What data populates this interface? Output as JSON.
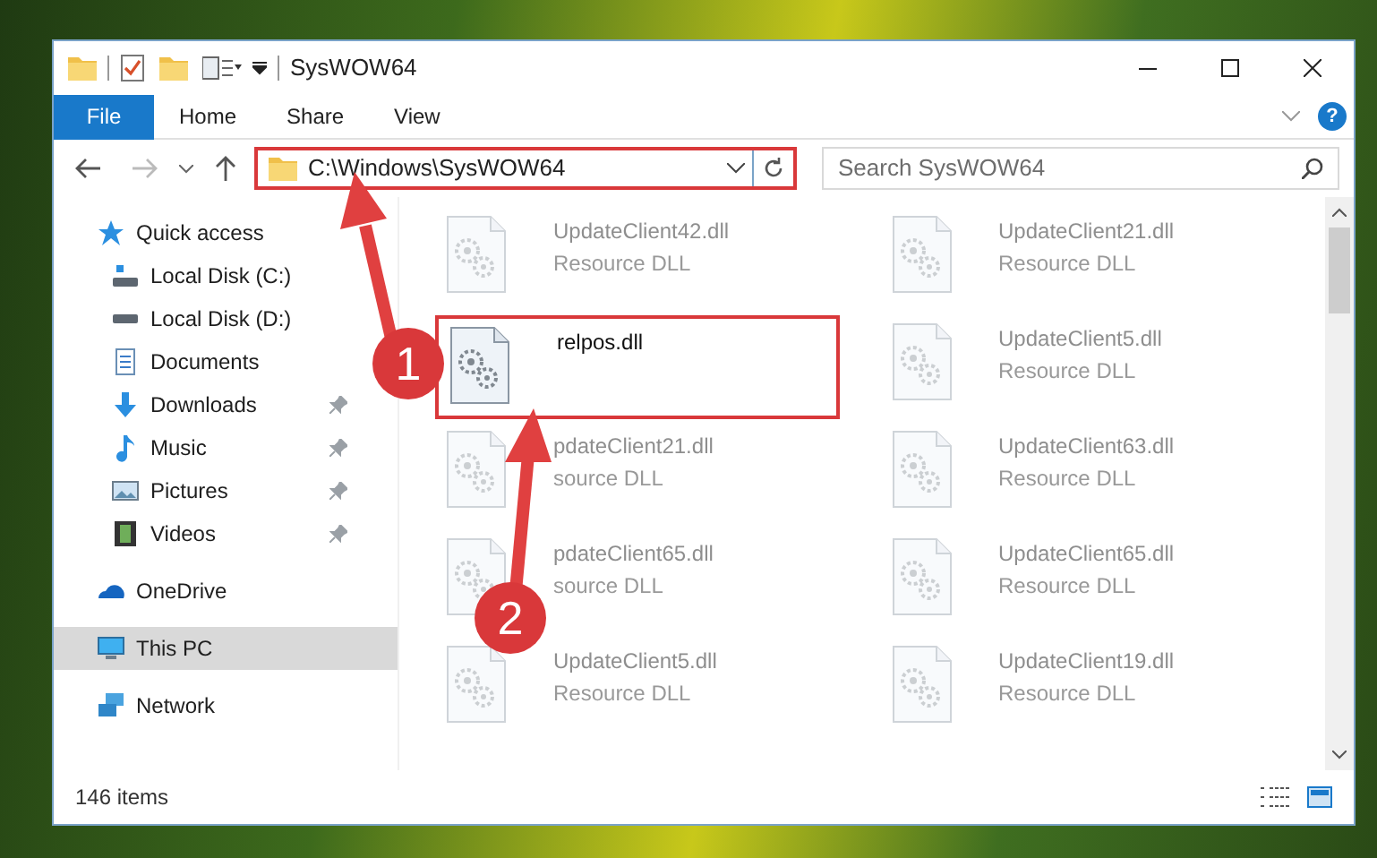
{
  "window": {
    "title": "SysWOW64"
  },
  "ribbon_tabs": [
    {
      "label": "File",
      "selected": true
    },
    {
      "label": "Home",
      "selected": false
    },
    {
      "label": "Share",
      "selected": false
    },
    {
      "label": "View",
      "selected": false
    }
  ],
  "address_bar": {
    "value": "C:\\Windows\\SysWOW64",
    "highlighted": true
  },
  "help": {
    "label": "?"
  },
  "search": {
    "placeholder": "Search SysWOW64"
  },
  "sidebar": {
    "items": [
      {
        "label": "Quick access",
        "selected": false,
        "children": [
          {
            "label": "Local Disk (C:)",
            "pinned": false,
            "selected": false
          },
          {
            "label": "Local Disk (D:)",
            "pinned": false,
            "selected": false
          },
          {
            "label": "Documents",
            "pinned": false,
            "selected": false
          },
          {
            "label": "Downloads",
            "pinned": true,
            "selected": false
          },
          {
            "label": "Music",
            "pinned": true,
            "selected": false
          },
          {
            "label": "Pictures",
            "pinned": true,
            "selected": false
          },
          {
            "label": "Videos",
            "pinned": true,
            "selected": false
          }
        ]
      },
      {
        "label": "OneDrive",
        "selected": false
      },
      {
        "label": "This PC",
        "selected": true
      },
      {
        "label": "Network",
        "selected": false
      }
    ]
  },
  "files": [
    {
      "name": "UpdateClient42.dll",
      "type": "Resource DLL",
      "highlighted": false
    },
    {
      "name": "UpdateClient21.dll",
      "type": "Resource DLL",
      "highlighted": false
    },
    {
      "name": "relpos.dll",
      "highlighted": true
    },
    {
      "name": "UpdateClient5.dll",
      "type": "Resource DLL",
      "highlighted": false
    },
    {
      "name": "pdateClient21.dll",
      "type": "source DLL",
      "highlighted": false
    },
    {
      "name": "UpdateClient63.dll",
      "type": "Resource DLL",
      "highlighted": false
    },
    {
      "name": "pdateClient65.dll",
      "type": "source DLL",
      "highlighted": false
    },
    {
      "name": "UpdateClient65.dll",
      "type": "Resource DLL",
      "highlighted": false
    },
    {
      "name": "UpdateClient5.dll",
      "type": "Resource DLL",
      "highlighted": false
    },
    {
      "name": "UpdateClient19.dll",
      "type": "Resource DLL",
      "highlighted": false
    }
  ],
  "status_bar": {
    "item_count": "146 items"
  },
  "callouts": [
    {
      "number": "1"
    },
    {
      "number": "2"
    }
  ]
}
